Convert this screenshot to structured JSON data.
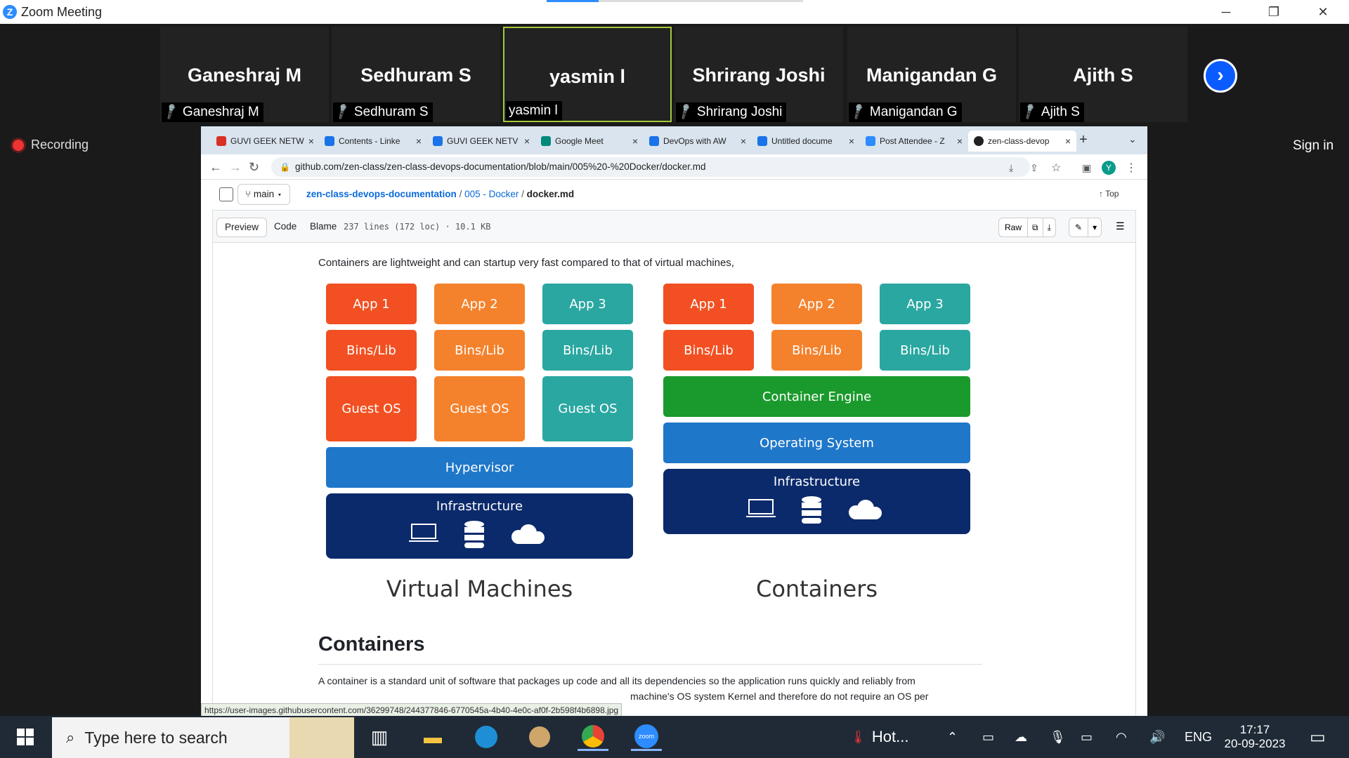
{
  "window": {
    "title": "Zoom Meeting",
    "logo": "Z"
  },
  "participants": [
    {
      "display": "Ganeshraj M",
      "name": "Ganeshraj M",
      "muted": true
    },
    {
      "display": "Sedhuram S",
      "name": "Sedhuram S",
      "muted": true
    },
    {
      "display": "yasmin l",
      "name": "yasmin l",
      "muted": false,
      "active": true
    },
    {
      "display": "Shrirang Joshi",
      "name": "Shrirang Joshi",
      "muted": true
    },
    {
      "display": "Manigandan G",
      "name": "Manigandan G",
      "muted": true
    },
    {
      "display": "Ajith S",
      "name": "Ajith S",
      "muted": true
    }
  ],
  "recording": "Recording",
  "signin": "Sign in",
  "browser": {
    "tabs": [
      {
        "label": "GUVI GEEK NETW",
        "color": "#d93025"
      },
      {
        "label": "Contents - Linke",
        "color": "#1a73e8"
      },
      {
        "label": "GUVI GEEK NETV",
        "color": "#1a73e8"
      },
      {
        "label": "Google Meet",
        "color": "#00897b"
      },
      {
        "label": "DevOps with AW",
        "color": "#1a73e8"
      },
      {
        "label": "Untitled docume",
        "color": "#1a73e8"
      },
      {
        "label": "Post Attendee - Z",
        "color": "#2d8cff"
      },
      {
        "label": "zen-class-devop",
        "color": "#222222"
      }
    ],
    "url": "github.com/zen-class/zen-class-devops-documentation/blob/main/005%20-%20Docker/docker.md",
    "profile": "Y"
  },
  "github": {
    "branch": "main",
    "repo": "zen-class-devops-documentation",
    "folder": "005 - Docker",
    "file": "docker.md",
    "top": "Top",
    "views": [
      "Preview",
      "Code",
      "Blame"
    ],
    "meta": "237 lines (172 loc) · 10.1 KB",
    "raw": "Raw"
  },
  "doc": {
    "intro": "Containers are lightweight and can startup very fast compared to that of virtual machines,",
    "heading": "Containers",
    "para1": "A container is a standard unit of software that packages up code and all its dependencies so the application runs quickly and reliably from",
    "para2_tail": "machine's OS system Kernel and therefore do not require an OS per"
  },
  "diagram": {
    "vm": {
      "apps": [
        "App 1",
        "App 2",
        "App 3"
      ],
      "bins": [
        "Bins/Lib",
        "Bins/Lib",
        "Bins/Lib"
      ],
      "guests": [
        "Guest OS",
        "Guest OS",
        "Guest OS"
      ],
      "hypervisor": "Hypervisor",
      "infra": "Infrastructure",
      "caption": "Virtual Machines"
    },
    "ct": {
      "apps": [
        "App 1",
        "App 2",
        "App 3"
      ],
      "bins": [
        "Bins/Lib",
        "Bins/Lib",
        "Bins/Lib"
      ],
      "engine": "Container Engine",
      "os": "Operating System",
      "infra": "Infrastructure",
      "caption": "Containers"
    }
  },
  "statusbar": "https://user-images.githubusercontent.com/36299748/244377846-6770545a-4b40-4e0c-af0f-2b598f4b6898.jpg",
  "taskbar": {
    "search": "Type here to search",
    "weather": "Hot...",
    "lang": "ENG",
    "time": "17:17",
    "date": "20-09-2023"
  }
}
